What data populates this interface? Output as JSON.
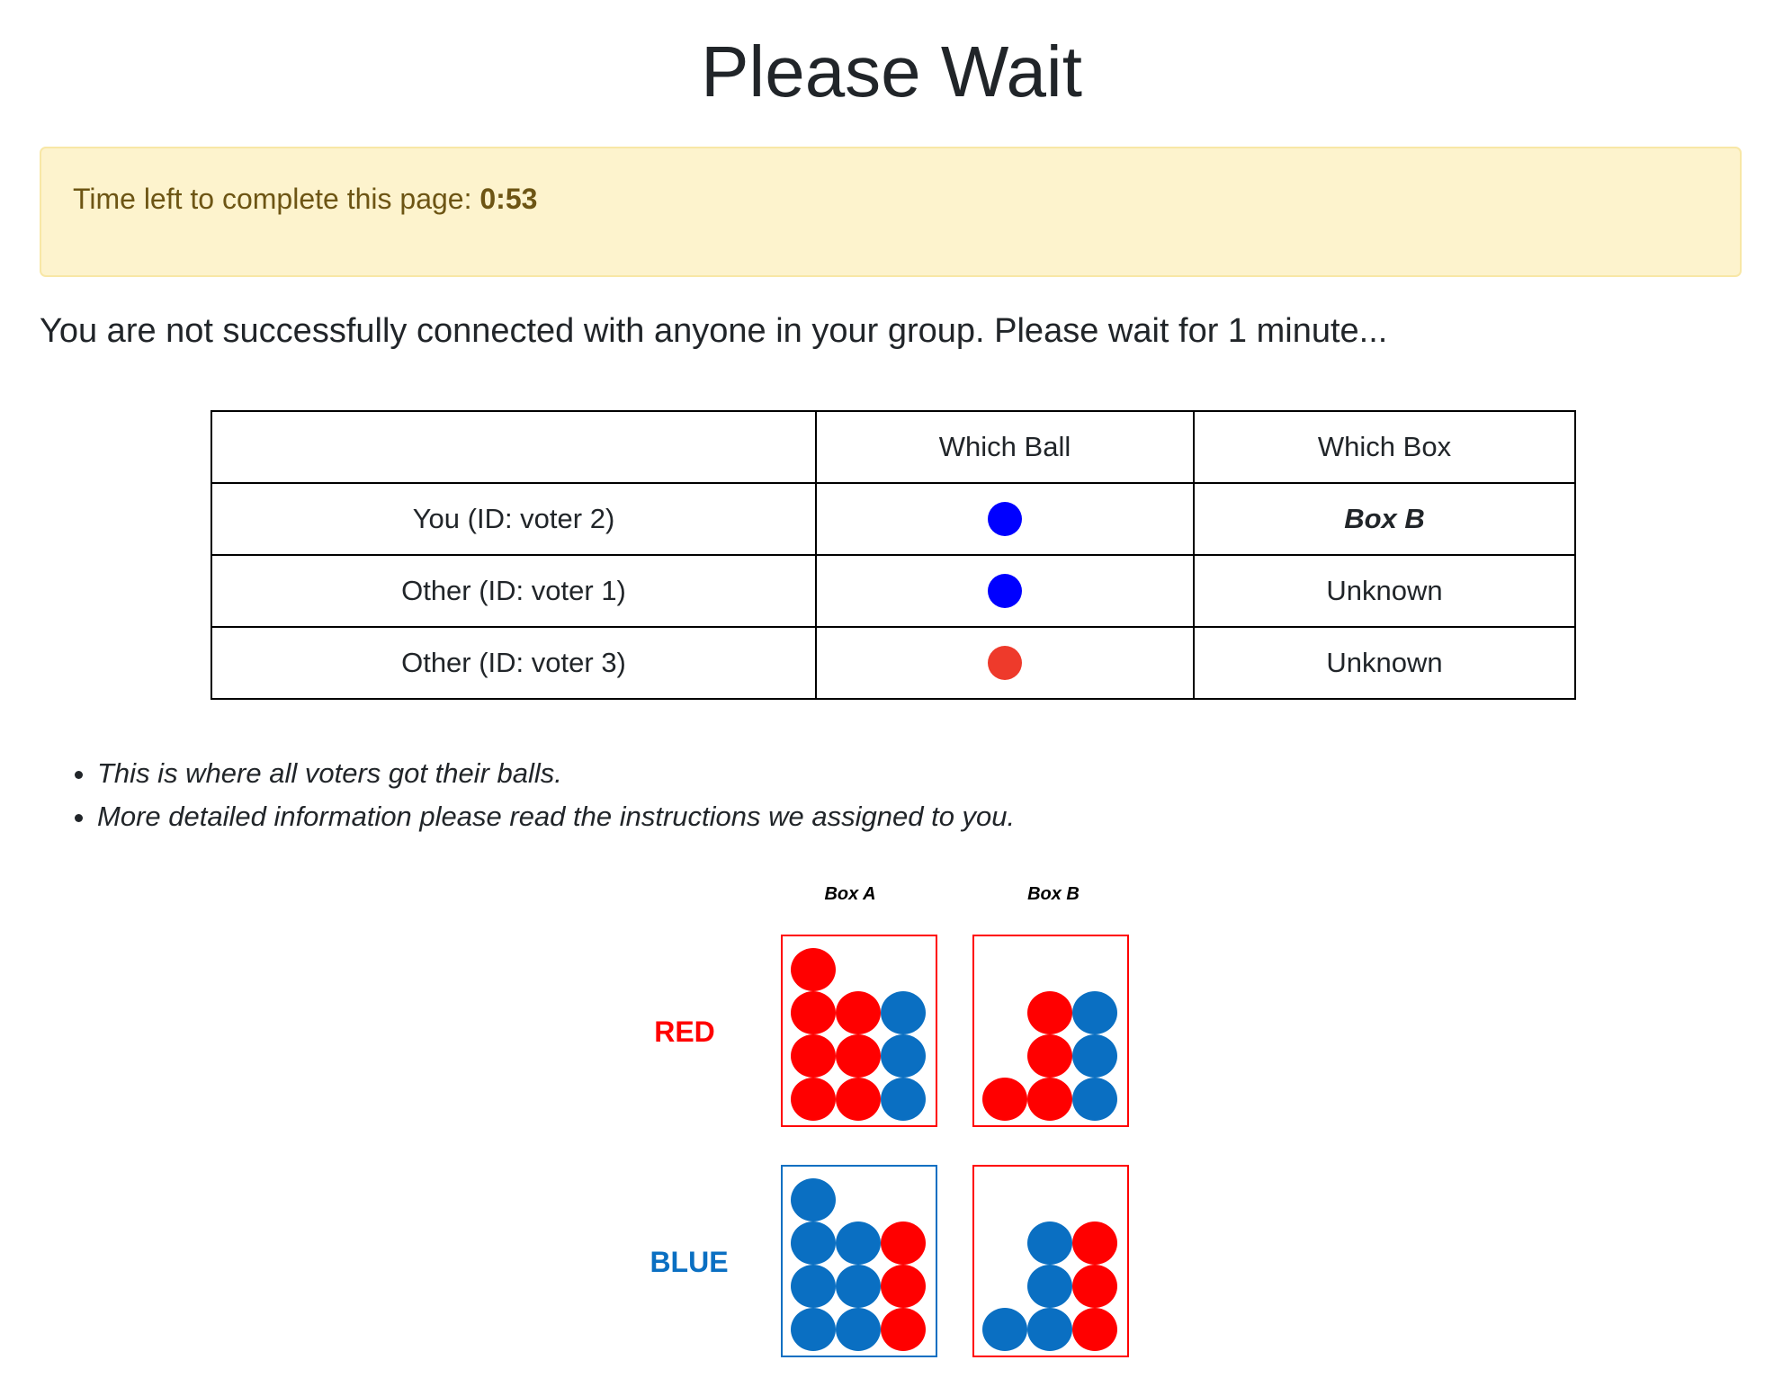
{
  "page": {
    "title": "Please Wait"
  },
  "timer": {
    "label": "Time left to complete this page:",
    "value": "0:53"
  },
  "status_message": "You are not successfully connected with anyone in your group. Please wait for 1 minute...",
  "table": {
    "headers": [
      "",
      "Which Ball",
      "Which Box"
    ],
    "rows": [
      {
        "who": "You (ID: voter 2)",
        "ball_color": "#0000ff",
        "box": "Box B",
        "box_emphasis": true
      },
      {
        "who": "Other (ID: voter 1)",
        "ball_color": "#0000ff",
        "box": "Unknown",
        "box_emphasis": false
      },
      {
        "who": "Other (ID: voter 3)",
        "ball_color": "#ee3a2b",
        "box": "Unknown",
        "box_emphasis": false
      }
    ]
  },
  "notes": [
    "This is where all voters got their balls.",
    "More detailed information please read the instructions we assigned to you."
  ],
  "diagram": {
    "box_labels": [
      "Box A",
      "Box B"
    ],
    "row_labels": [
      {
        "label": "RED",
        "color": "#ff0000"
      },
      {
        "label": "BLUE",
        "color": "#0a6fc2"
      }
    ],
    "colors": {
      "red": "#ff0000",
      "blue": "#0a6fc2"
    },
    "grids": [
      {
        "row": 0,
        "box": 0,
        "frame": "red",
        "columns": [
          [
            "red",
            "red",
            "red",
            "red"
          ],
          [
            "red",
            "red",
            "red"
          ],
          [
            "blue",
            "blue",
            "blue"
          ]
        ]
      },
      {
        "row": 0,
        "box": 1,
        "frame": "red",
        "columns": [
          [
            "red"
          ],
          [
            "red",
            "red",
            "red"
          ],
          [
            "blue",
            "blue",
            "blue"
          ]
        ]
      },
      {
        "row": 1,
        "box": 0,
        "frame": "blue",
        "columns": [
          [
            "blue",
            "blue",
            "blue",
            "blue"
          ],
          [
            "blue",
            "blue",
            "blue"
          ],
          [
            "red",
            "red",
            "red"
          ]
        ]
      },
      {
        "row": 1,
        "box": 1,
        "frame": "red",
        "columns": [
          [
            "blue"
          ],
          [
            "blue",
            "blue",
            "blue"
          ],
          [
            "red",
            "red",
            "red"
          ]
        ]
      }
    ]
  }
}
